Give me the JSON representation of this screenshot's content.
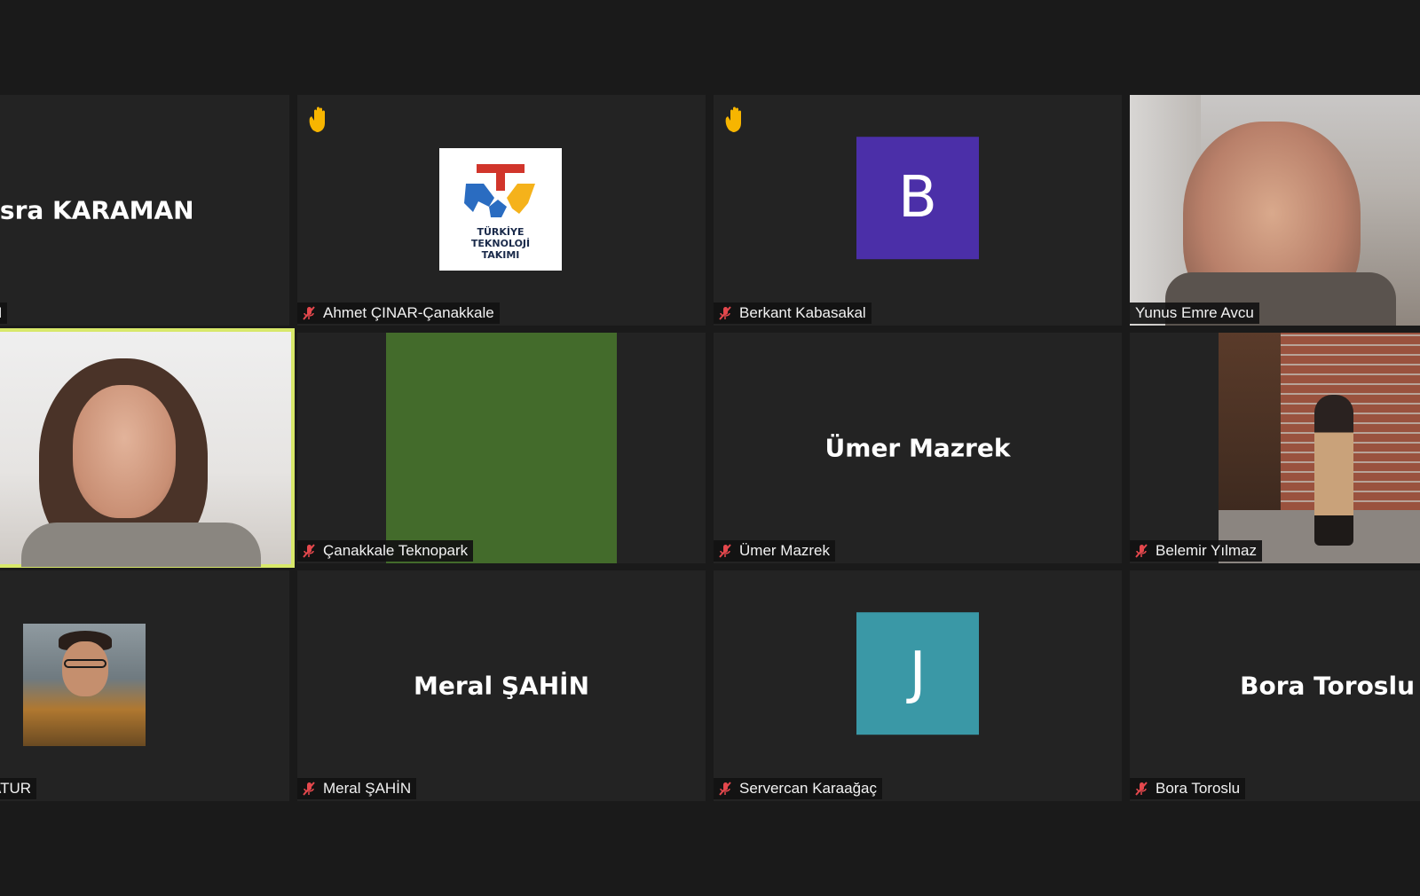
{
  "colors": {
    "background": "#1a1a1a",
    "tile": "#232323",
    "active_speaker_border": "#d8e86a",
    "raised_hand": "#f7b500",
    "muted_icon": "#e5484d"
  },
  "tiles": [
    {
      "big_name": "üsra KARAMAN",
      "label": "N",
      "muted": false,
      "hand_raised": false,
      "kind": "name-card"
    },
    {
      "label": "Ahmet ÇINAR-Çanakkale",
      "muted": true,
      "hand_raised": true,
      "kind": "logo",
      "logo_text": [
        "TÜRKİYE",
        "TEKNOLOJİ",
        "TAKIMI"
      ]
    },
    {
      "label": "Berkant Kabasakal",
      "muted": true,
      "hand_raised": true,
      "kind": "avatar",
      "avatar_letter": "B",
      "avatar_color": "#4b2fa8"
    },
    {
      "label": "Yunus Emre Avcu",
      "muted": false,
      "hand_raised": false,
      "kind": "video"
    },
    {
      "label": "",
      "muted": false,
      "hand_raised": false,
      "kind": "video",
      "active_speaker": true
    },
    {
      "label": "Çanakkale Teknopark",
      "muted": true,
      "hand_raised": false,
      "kind": "video-solid",
      "fill_color": "#436b2b"
    },
    {
      "big_name": "Ümer Mazrek",
      "label": "Ümer Mazrek",
      "muted": true,
      "hand_raised": false,
      "kind": "name-card"
    },
    {
      "label": "Belemir Yılmaz",
      "muted": true,
      "hand_raised": false,
      "kind": "video"
    },
    {
      "label": "ATUR",
      "muted": false,
      "hand_raised": false,
      "kind": "avatar-photo"
    },
    {
      "big_name": "Meral ŞAHİN",
      "label": "Meral ŞAHİN",
      "muted": true,
      "hand_raised": false,
      "kind": "name-card"
    },
    {
      "label": "Servercan Karaağaç",
      "muted": true,
      "hand_raised": false,
      "kind": "avatar",
      "avatar_letter": "J",
      "avatar_color": "#3a98a6"
    },
    {
      "big_name": "Bora Toroslu",
      "label": "Bora Toroslu",
      "muted": true,
      "hand_raised": false,
      "kind": "name-card"
    }
  ]
}
